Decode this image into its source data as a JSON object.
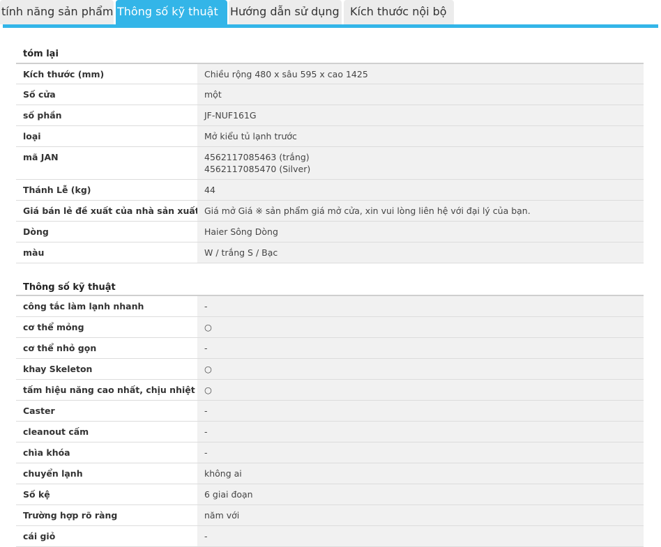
{
  "tabs": [
    {
      "label": "tính năng sản phẩm",
      "active": false
    },
    {
      "label": "Thông số kỹ thuật",
      "active": true
    },
    {
      "label": "Hướng dẫn sử dụng",
      "active": false
    },
    {
      "label": "Kích thước nội bộ",
      "active": false
    }
  ],
  "colors": {
    "accent": "#33b5e8",
    "value_bg": "#f1f1f1"
  },
  "summary": {
    "title": "tóm lại",
    "rows": [
      {
        "label": "Kích thước (mm)",
        "value": "Chiều rộng 480 x sâu 595 x cao 1425"
      },
      {
        "label": "Số cửa",
        "value": "một"
      },
      {
        "label": "số phần",
        "value": "JF-NUF161G"
      },
      {
        "label": "loại",
        "value": "Mở kiểu tủ lạnh trước"
      },
      {
        "label": "mã JAN",
        "values": [
          "4562117085463 (trắng)",
          "4562117085470 (Silver)"
        ]
      },
      {
        "label": "Thánh Lễ (kg)",
        "value": "44"
      },
      {
        "label": "Giá bán lẻ đề xuất của nhà sản xuất",
        "value": "Giá mở Giá ※ sản phẩm giá mở cửa, xin vui lòng liên hệ với đại lý của bạn."
      },
      {
        "label": "Dòng",
        "value": "Haier Sông Dòng"
      },
      {
        "label": "màu",
        "value": "W / trắng S / Bạc"
      }
    ]
  },
  "specs": {
    "title": "Thông số kỹ thuật",
    "rows": [
      {
        "label": "công tắc làm lạnh nhanh",
        "value": "-"
      },
      {
        "label": "cơ thể mỏng",
        "value": "○"
      },
      {
        "label": "cơ thể nhỏ gọn",
        "value": "-"
      },
      {
        "label": "khay Skeleton",
        "value": "○"
      },
      {
        "label": "tấm hiệu năng cao nhất, chịu nhiệt",
        "value": "○"
      },
      {
        "label": "Caster",
        "value": "-"
      },
      {
        "label": "cleanout cấm",
        "value": "-"
      },
      {
        "label": "chìa khóa",
        "value": "-"
      },
      {
        "label": "chuyển lạnh",
        "value": "không ai"
      },
      {
        "label": "Số kệ",
        "value": "6 giai đoạn"
      },
      {
        "label": "Trường hợp rõ ràng",
        "value": "năm với"
      },
      {
        "label": "cái giỏ",
        "value": "-"
      }
    ]
  }
}
